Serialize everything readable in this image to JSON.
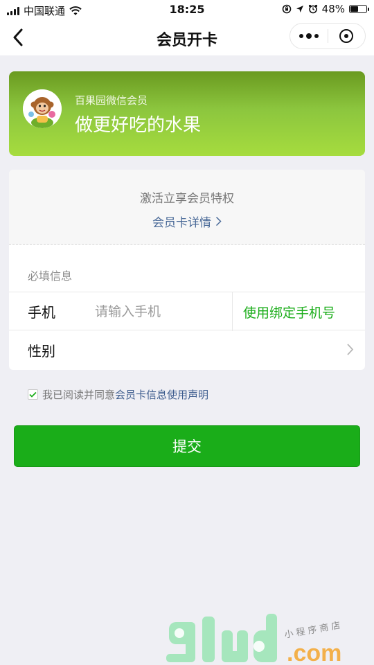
{
  "status_bar": {
    "carrier": "中国联通",
    "time": "18:25",
    "battery_percent": "48%",
    "battery_level": 0.48
  },
  "nav": {
    "title": "会员开卡"
  },
  "card": {
    "brand": "百果园微信会员",
    "slogan": "做更好吃的水果"
  },
  "privilege": {
    "title": "激活立享会员特权",
    "link": "会员卡详情"
  },
  "form": {
    "section_label": "必填信息",
    "phone_label": "手机",
    "phone_placeholder": "请输入手机",
    "bind_phone": "使用绑定手机号",
    "gender_label": "性别"
  },
  "agreement": {
    "checked": true,
    "prefix": "我已阅读并同意",
    "link": "会员卡信息使用声明"
  },
  "submit": {
    "label": "提交"
  },
  "watermark": {
    "logo": "91ud.com",
    "tagline": "小程序商店"
  },
  "colors": {
    "accent_green": "#1aad19",
    "link_blue": "#4a6a98",
    "card_green": "#8cc63e"
  }
}
